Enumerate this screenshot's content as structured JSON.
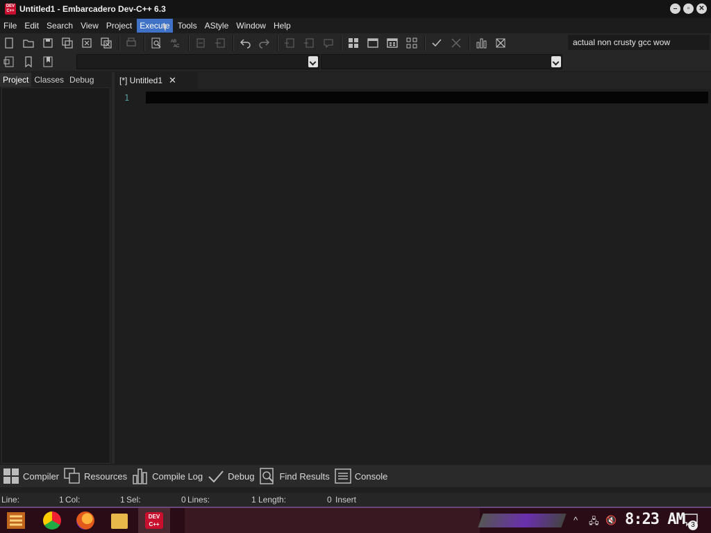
{
  "window": {
    "title": "Untitled1 - Embarcadero Dev-C++ 6.3",
    "logo_text": "DEV C++"
  },
  "menu": [
    "File",
    "Edit",
    "Search",
    "View",
    "Project",
    "Execute",
    "Tools",
    "AStyle",
    "Window",
    "Help"
  ],
  "toolbar": {
    "search_text": "actual non crusty gcc wow"
  },
  "left_tabs": [
    "Project",
    "Classes",
    "Debug"
  ],
  "editor": {
    "tab_label": "[*] Untitled1",
    "line_number": "1"
  },
  "bottom_tabs": [
    "Compiler",
    "Resources",
    "Compile Log",
    "Debug",
    "Find Results",
    "Console"
  ],
  "status": {
    "line_label": "Line:",
    "line_value": "1",
    "col_label": "Col:",
    "col_value": "1",
    "sel_label": "Sel:",
    "sel_value": "0",
    "lines_label": "Lines:",
    "lines_value": "1",
    "length_label": "Length:",
    "length_value": "0",
    "mode": "Insert"
  },
  "taskbar": {
    "clock": "8:23 AM",
    "notification_count": "3"
  },
  "colors": {
    "accent": "#3f72c6",
    "brand": "#c8102e"
  }
}
